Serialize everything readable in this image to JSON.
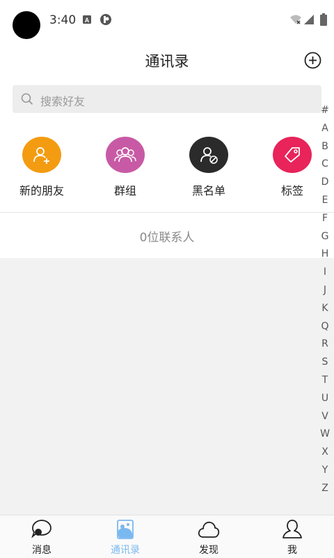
{
  "status_bar": {
    "time": "3:40",
    "a_badge": "A"
  },
  "header": {
    "title": "通讯录"
  },
  "search": {
    "placeholder": "搜索好友"
  },
  "quick_actions": [
    {
      "label": "新的朋友",
      "icon": "add-user-icon",
      "color": "#f39c12"
    },
    {
      "label": "群组",
      "icon": "group-icon",
      "color": "#c85aa5"
    },
    {
      "label": "黑名单",
      "icon": "blocked-user-icon",
      "color": "#2b2b2b"
    },
    {
      "label": "标签",
      "icon": "tag-icon",
      "color": "#e8245a"
    }
  ],
  "contacts_count": "0位联系人",
  "index_letters": [
    "#",
    "A",
    "B",
    "C",
    "D",
    "E",
    "F",
    "G",
    "H",
    "I",
    "J",
    "K",
    "Q",
    "R",
    "S",
    "T",
    "U",
    "V",
    "W",
    "X",
    "Y",
    "Z"
  ],
  "tabs": [
    {
      "label": "消息",
      "icon": "chat-icon",
      "active": false
    },
    {
      "label": "通讯录",
      "icon": "contacts-icon",
      "active": true
    },
    {
      "label": "发现",
      "icon": "cloud-icon",
      "active": false
    },
    {
      "label": "我",
      "icon": "profile-icon",
      "active": false
    }
  ],
  "colors": {
    "active_tab": "#7ab8f0",
    "background": "#f2f2f2"
  }
}
